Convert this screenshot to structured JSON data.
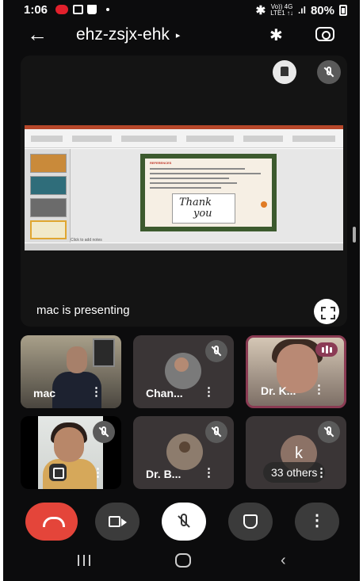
{
  "status_bar": {
    "time": "1:06",
    "network_top": "Vo)) 4G",
    "network_bottom": "LTE1 ↑↓",
    "battery": "80%"
  },
  "header": {
    "meeting_code": "ehz-zsjx-ehk",
    "caret": "▸",
    "bluetooth_icon": "bluetooth-icon",
    "switch_camera_icon": "switch-camera-icon"
  },
  "presentation": {
    "presenter_label": "mac is presenting",
    "slide": {
      "heading": "REFERENCES",
      "closing_text_1": "Thank",
      "closing_text_2": "you"
    },
    "notes_placeholder": "Click to add notes"
  },
  "participants": [
    {
      "name": "mac",
      "muted": false
    },
    {
      "name": "Chan...",
      "muted": true
    },
    {
      "name": "Dr. K...",
      "muted": false,
      "speaking": true
    },
    {
      "name": "",
      "muted": true
    },
    {
      "name": "Dr. B...",
      "muted": true
    },
    {
      "name": "k",
      "muted": true,
      "avatar_letter": "k"
    }
  ],
  "others_count_label": "33 others",
  "more_label": "⋮",
  "controls": {
    "end_call": "end-call-icon",
    "camera": "videocam-icon",
    "microphone": "mic-off-icon",
    "raise_hand": "hand-icon",
    "more_options": "⋮"
  },
  "colors": {
    "end_call": "#e4453a",
    "speaking_border": "#8a3b53",
    "tile_bg": "#3a3536",
    "background": "#0c0c0d"
  }
}
